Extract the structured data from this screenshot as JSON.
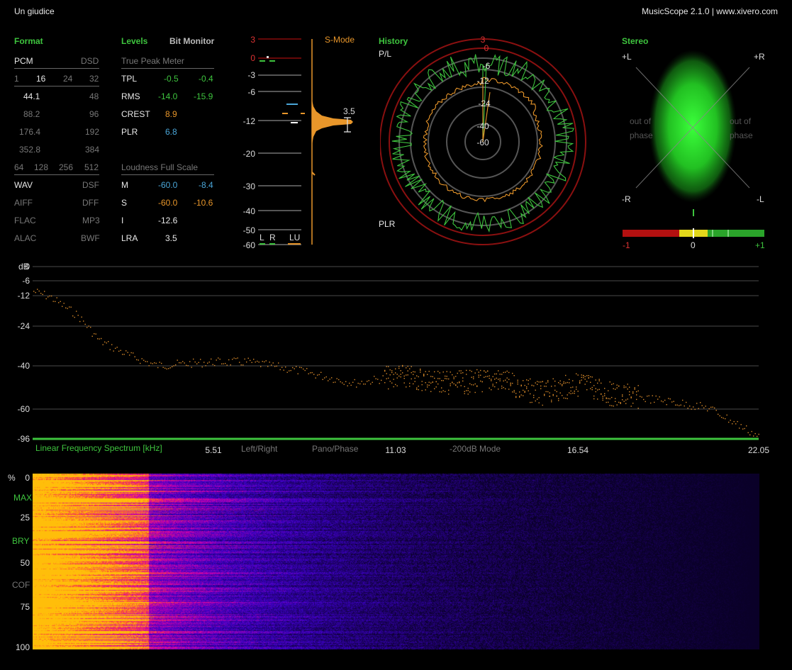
{
  "title": "Un giudice",
  "app": "MusicScope 2.1.0 | www.xivero.com",
  "format": {
    "header": "Format",
    "pcm": "PCM",
    "dsd": "DSD",
    "bits": [
      "1",
      "16",
      "24",
      "32"
    ],
    "rates": [
      [
        "44.1",
        "48"
      ],
      [
        "88.2",
        "96"
      ],
      [
        "176.4",
        "192"
      ],
      [
        "352.8",
        "384"
      ]
    ],
    "dsd_rates": [
      "64",
      "128",
      "256",
      "512"
    ],
    "formats": [
      [
        "WAV",
        "DSF"
      ],
      [
        "AIFF",
        "DFF"
      ],
      [
        "FLAC",
        "MP3"
      ],
      [
        "ALAC",
        "BWF"
      ]
    ]
  },
  "levels": {
    "header": "Levels",
    "bitmon": "Bit Monitor",
    "tp_header": "True Peak Meter",
    "rows": [
      {
        "label": "TPL",
        "a": "-0.5",
        "b": "-0.4"
      },
      {
        "label": "RMS",
        "a": "-14.0",
        "b": "-15.9"
      },
      {
        "label": "CREST",
        "a": "8.9"
      },
      {
        "label": "PLR",
        "a": "6.8"
      }
    ],
    "lfs_header": "Loudness Full Scale",
    "lrows": [
      {
        "label": "M",
        "a": "-60.0",
        "b": "-8.4"
      },
      {
        "label": "S",
        "a": "-60.0",
        "b": "-10.6"
      },
      {
        "label": "I",
        "a": "-12.6"
      },
      {
        "label": "LRA",
        "a": "3.5"
      }
    ]
  },
  "meter": {
    "scale": [
      "3",
      "0",
      "-3",
      "-6",
      "-12",
      "-20",
      "-30",
      "-40",
      "-50",
      "-60"
    ],
    "smode": "S-Mode",
    "lra_value": "3.5",
    "chan": [
      "L",
      "R",
      "LU"
    ]
  },
  "history": {
    "header": "History",
    "pl": "P/L",
    "plr": "PLR",
    "rings": [
      "3",
      "0",
      "-6",
      "-12",
      "-24",
      "-40",
      "-60"
    ]
  },
  "stereo": {
    "header": "Stereo",
    "corners": [
      "+L",
      "+R",
      "-R",
      "-L"
    ],
    "oop": [
      "out of",
      "phase"
    ],
    "corr": [
      "-1",
      "0",
      "+1"
    ]
  },
  "spectrum": {
    "db": "dB",
    "y": [
      "0",
      "-6",
      "-12",
      "-24",
      "-40",
      "-60",
      "-96"
    ],
    "title": "Linear Frequency Spectrum [kHz]",
    "x": [
      "5.51",
      "11.03",
      "16.54",
      "22.05"
    ],
    "buttons": [
      "Left/Right",
      "Pano/Phase",
      "-200dB Mode"
    ]
  },
  "spectrogram": {
    "pct": "%",
    "y": [
      "0",
      "25",
      "50",
      "75",
      "100"
    ],
    "markers": [
      "MAX",
      "BRY",
      "COF"
    ]
  },
  "colors": {
    "green": "#3ec43e",
    "orange": "#e8962a",
    "blue": "#4aa6d8",
    "red": "#cc1111"
  }
}
